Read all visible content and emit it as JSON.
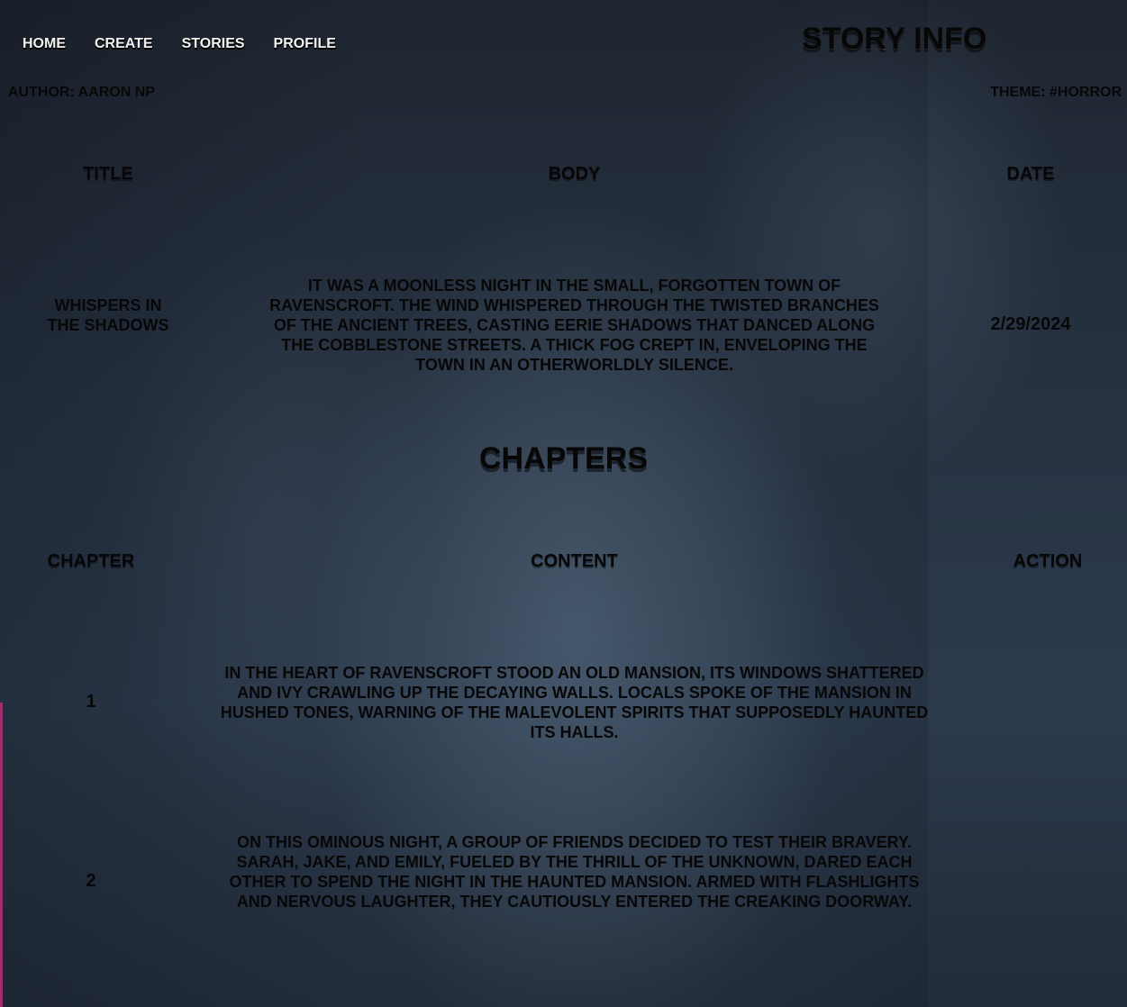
{
  "nav": {
    "items": [
      "HOME",
      "CREATE",
      "STORIES",
      "PROFILE"
    ]
  },
  "page_title": "STORY INFO",
  "author_line": "AUTHOR: AARON NP",
  "theme_line": "THEME: #HORROR",
  "story_table": {
    "headers": [
      "TITLE",
      "BODY",
      "DATE"
    ],
    "row": {
      "title": "WHISPERS IN THE SHADOWS",
      "body": "IT WAS A MOONLESS NIGHT IN THE SMALL, FORGOTTEN TOWN OF RAVENSCROFT. THE WIND WHISPERED THROUGH THE TWISTED BRANCHES OF THE ANCIENT TREES, CASTING EERIE SHADOWS THAT DANCED ALONG THE COBBLESTONE STREETS. A THICK FOG CREPT IN, ENVELOPING THE TOWN IN AN OTHERWORLDLY SILENCE.",
      "date": "2/29/2024"
    }
  },
  "chapters_title": "CHAPTERS",
  "chapters_table": {
    "headers": [
      "CHAPTER",
      "CONTENT",
      "ACTION"
    ],
    "rows": [
      {
        "chapter": "1",
        "content": "IN THE HEART OF RAVENSCROFT STOOD AN OLD MANSION, ITS WINDOWS SHATTERED AND IVY CRAWLING UP THE DECAYING WALLS. LOCALS SPOKE OF THE MANSION IN HUSHED TONES, WARNING OF THE MALEVOLENT SPIRITS THAT SUPPOSEDLY HAUNTED ITS HALLS."
      },
      {
        "chapter": "2",
        "content": "ON THIS OMINOUS NIGHT, A GROUP OF FRIENDS DECIDED TO TEST THEIR BRAVERY. SARAH, JAKE, AND EMILY, FUELED BY THE THRILL OF THE UNKNOWN, DARED EACH OTHER TO SPEND THE NIGHT IN THE HAUNTED MANSION. ARMED WITH FLASHLIGHTS AND NERVOUS LAUGHTER, THEY CAUTIOUSLY ENTERED THE CREAKING DOORWAY."
      }
    ]
  }
}
